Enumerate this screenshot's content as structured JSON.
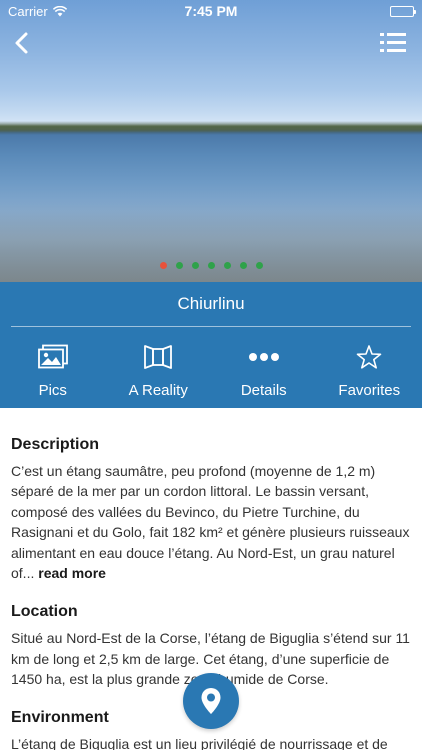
{
  "status_bar": {
    "carrier": "Carrier",
    "time": "7:45 PM"
  },
  "header": {
    "back_icon": "chevron-left-icon",
    "menu_icon": "list-menu-icon"
  },
  "carousel": {
    "slide_count": 7,
    "active_index": 0,
    "active_color": "#e8523b",
    "inactive_color": "#2fa24a"
  },
  "place": {
    "title": "Chiurlinu"
  },
  "tabs": [
    {
      "label": "Pics",
      "icon": "photos-icon"
    },
    {
      "label": "A Reality",
      "icon": "panorama-icon"
    },
    {
      "label": "Details",
      "icon": "more-dots-icon"
    },
    {
      "label": "Favorites",
      "icon": "star-icon"
    }
  ],
  "sections": {
    "description": {
      "heading": "Description",
      "text": "C’est un étang saumâtre, peu profond (moyenne de 1,2 m) séparé de la mer par un cordon littoral. Le bassin versant, composé des vallées du Bevinco, du Pietre Turchine, du Rasignani et du Golo, fait 182 km² et génère plusieurs ruisseaux alimentant en eau douce l’étang. Au Nord-Est, un grau naturel of...",
      "read_more": "read more"
    },
    "location": {
      "heading": "Location",
      "text": "Situé au Nord-Est de la Corse, l’étang de Biguglia s’étend sur 11 km de long et 2,5 km de large. Cet étang, d’une superficie de 1450 ha, est la plus grande zone humide de Corse."
    },
    "environment": {
      "heading": "Environment",
      "text": "L’étang de Biguglia est un lieu privilégié de nourrissage et de"
    }
  },
  "fab": {
    "icon": "map-pin-icon"
  },
  "colors": {
    "primary": "#2a78b3",
    "text": "#333333"
  }
}
